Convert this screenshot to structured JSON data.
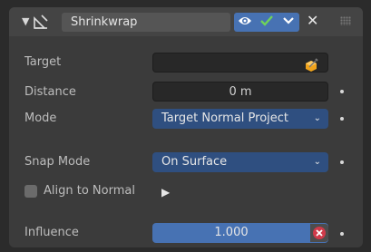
{
  "header": {
    "modifier_name": "Shrinkwrap",
    "icons": [
      "collapse-arrow-icon",
      "shrinkwrap-modifier-icon",
      "eye-icon",
      "checkmark-icon",
      "chevron-down-icon",
      "close-icon",
      "drag-grip-icon"
    ],
    "accent_color": "#4772b3"
  },
  "fields": {
    "target_label": "Target",
    "target_value": "",
    "distance_label": "Distance",
    "distance_value": "0 m",
    "mode_label": "Mode",
    "mode_value": "Target Normal Project",
    "snap_mode_label": "Snap Mode",
    "snap_mode_value": "On Surface",
    "align_to_normal_label": "Align to Normal",
    "align_to_normal_checked": false,
    "influence_label": "Influence",
    "influence_value": "1.000"
  }
}
